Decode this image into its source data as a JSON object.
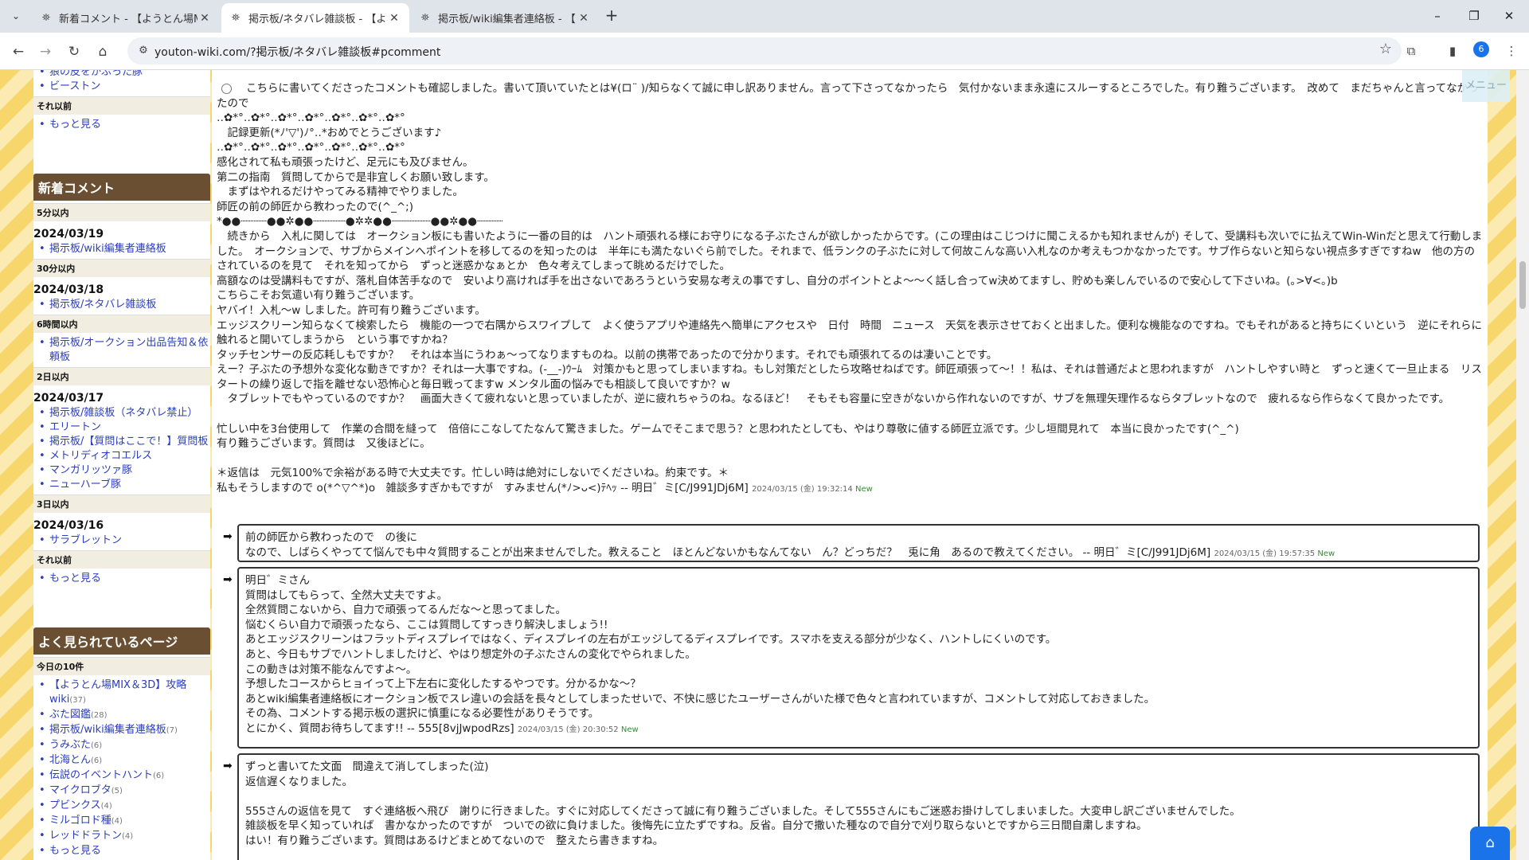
{
  "browser": {
    "tabs": [
      {
        "title": "新着コメント - 【ようとん場MIX＆3D",
        "active": false
      },
      {
        "title": "掲示板/ネタバレ雑談板 - 【ようとん",
        "active": true
      },
      {
        "title": "掲示板/wiki編集者連絡板 - 【よう",
        "active": false
      }
    ],
    "url": "youton-wiki.com/?掲示板/ネタバレ雑談板#pcomment",
    "profile_initial": "6",
    "icons": {
      "back": "←",
      "forward": "→",
      "reload": "↻",
      "home": "⌂",
      "star": "☆",
      "extensions": "⧉",
      "sidepanel": "▮",
      "more": "⋮",
      "tabmenu": "⌄",
      "newtab": "+",
      "minimize": "–",
      "restore": "❐",
      "close": "✕",
      "favicon": "⛯",
      "tab_close": "✕",
      "site": "⚙"
    }
  },
  "sidebar": {
    "top_items": [
      "狼の皮をかぶった豚",
      "ビーストン"
    ],
    "before_label": "それ以前",
    "more_label": "もっと見る",
    "recent_comments": {
      "heading": "新着コメント",
      "sections": [
        {
          "label": "5分以内",
          "date": "2024/03/19",
          "items": [
            "掲示板/wiki編集者連絡板"
          ]
        },
        {
          "label": "30分以内",
          "date": "2024/03/18",
          "items": [
            "掲示板/ネタバレ雑談板"
          ]
        },
        {
          "label": "6時間以内",
          "date": "",
          "items": [
            "掲示板/オークション出品告知＆依頼板"
          ]
        },
        {
          "label": "2日以内",
          "date": "2024/03/17",
          "items": [
            "掲示板/雑談板（ネタバレ禁止）",
            "エリートン",
            "掲示板/【質問はここで！】質問板",
            "メトリディオコエルス",
            "マンガリッツァ豚",
            "ニューハーブ豚"
          ]
        },
        {
          "label": "3日以内",
          "date": "2024/03/16",
          "items": [
            "サラブレットン"
          ]
        }
      ],
      "before_label": "それ以前",
      "more_label": "もっと見る"
    },
    "popular": {
      "heading": "よく見られているページ",
      "label": "今日の10件",
      "items": [
        {
          "name": "【ようとん場MIX＆3D】攻略wiki",
          "count": "(37)"
        },
        {
          "name": "ぶた図鑑",
          "count": "(28)"
        },
        {
          "name": "掲示板/wiki編集者連絡板",
          "count": "(7)"
        },
        {
          "name": "うみぶた",
          "count": "(6)"
        },
        {
          "name": "北海とん",
          "count": "(6)"
        },
        {
          "name": "伝説のイベントハント",
          "count": "(6)"
        },
        {
          "name": "マイクロブタ",
          "count": "(5)"
        },
        {
          "name": "プビンクス",
          "count": "(4)"
        },
        {
          "name": "ミルゴロド種",
          "count": "(4)"
        },
        {
          "name": "レッドドラトン",
          "count": "(4)"
        }
      ],
      "more_label": "もっと見る"
    }
  },
  "comment": {
    "lines": [
      "こちらに書いてくださったコメントも確認しました。書いて頂いていたとは¥(ロ¨ )/知らなくて誠に申し訳ありません。言って下さってなかったら　気付かないまま永遠にスルーするところでした。有り難うございます。　改めて　まだちゃんと言ってなかったので",
      "‥✿*°‥✿*°‥✿*°‥✿*°‥✿*°‥✿*°‥✿*°",
      "　記録更新(*ﾉ'▽')ﾉ°‥*おめでとうございます♪",
      "‥✿*°‥✿*°‥✿*°‥✿*°‥✿*°‥✿*°‥✿*°",
      "感化されて私も頑張ったけど、足元にも及びません。",
      "第二の指南　質問してからで是非宜しくお願い致します。",
      "　まずはやれるだけやってみる精神でやりました。",
      "師匠の前の師匠から教わったので(^_^;)",
      "*●●┈┈┈┈●●✲●●┈┈┈┈┈●✲✲●●┈┈┈┈┈┈●●✲●●┈┈┈┈",
      "　続きから　入札に関しては　オークション板にも書いたように一番の目的は　ハント頑張れる様にお守りになる子ぶたさんが欲しかったからです。(この理由はこじつけに聞こえるかも知れませんが) そして、受講料も次いでに払えてWin-Winだと思えて行動しました。　オークションで、サブからメインへポイントを移してるのを知ったのは　半年にも満たないぐら前でした。それまで、低ランクの子ぶたに対して何故こんな高い入札なのか考えもつかなかったです。サブ作らないと知らない視点多すぎですねw　他の方のされているのを見て　それを知ってから　ずっと迷惑かなぁとか　色々考えてしまって眺めるだけでした。",
      "高額なのは受講料もですが、落札自体苦手なので　安いより高ければ手を出さないであろうという安易な考えの事ですし、自分のポイントとよ〜〜く話し合ってw決めてますし、貯めも楽しんでいるので安心して下さいね。(｡>∀<｡)b",
      "こちらこそお気遣い有り難うございます。",
      "ヤバイ！入札〜w しました。許可有り難うございます。",
      "エッジスクリーン知らなくて検索したら　機能の一つで右隅からスワイプして　よく使うアプリや連絡先へ簡単にアクセスや　日付　時間　ニュース　天気を表示させておくと出ました。便利な機能なのですね。でもそれがあると持ちにくいという　逆にそれらに触れると開いてしまうから　という事ですかね？",
      "タッチセンサーの反応耗しもですか？　それは本当にうわぁ〜ってなりますものね。以前の携帯であったので分かります。それでも頑張れてるのは凄いことです。",
      "えー？子ぶたの予想外な変化な動きですか？それは一大事ですね。(-__-)ｳｰﾑ　対策かもと思ってしまいますね。もし対策だとしたら攻略せねばです。師匠頑張って〜！！私は、それは普通だよと思われますが　ハントしやすい時と　ずっと速くて一旦止まる　リスタートの繰り返しで指を離せない恐怖心と毎日戦ってますw メンタル面の悩みでも相談して良いですか？w",
      "　タブレットでもやっているのですか？　画面大きくて疲れないと思っていましたが、逆に疲れちゃうのね。なるほど！　そもそも容量に空きがないから作れないのですが、サブを無理矢理作るならタブレットなので　疲れるなら作らなくて良かったです。",
      "",
      "忙しい中を3台使用して　作業の合間を縫って　倍倍にこなしてたなんて驚きました。ゲームでそこまで思う？と思われたとしても、やはり尊敬に値する師匠立派です。少し垣間見れて　本当に良かったです(^_^)",
      "有り難うございます。質問は　又後ほどに。",
      "",
      "＊返信は　元気100%で余裕がある時で大丈夫です。忙しい時は絶対にしないでくださいね。約束です。＊"
    ],
    "last_line": "私もそうしますので o(*^▽^*)o　雑談多すぎかもですが　すみません(*ﾉ>ᴗ<)ﾃﾍｯ",
    "author": "-- 明日゛ミ[C/J991JDj6M]",
    "timestamp": "2024/03/15 (金) 19:32:14",
    "new_label": "New"
  },
  "replies": [
    {
      "lines": [
        "前の師匠から教わったので　の後に"
      ],
      "last_line": "なので、しばらくやってて悩んでも中々質問することが出来ませんでした。教えること　ほとんどないかもなんてない　ん？どっちだ？　兎に角　あるので教えてください。",
      "author": "-- 明日゛ミ[C/J991JDj6M]",
      "timestamp": "2024/03/15 (金) 19:57:35",
      "new_label": "New"
    },
    {
      "lines": [
        "明日゛ミさん",
        "質問はしてもらって、全然大丈夫ですよ。",
        "全然質問こないから、自力で頑張ってるんだな〜と思ってました。",
        "悩むくらい自力で頑張ったなら、ここは質問してすっきり解決しましょう!!",
        "あとエッジスクリーンはフラットディスプレイではなく、ディスプレイの左右がエッジしてるディスプレイです。スマホを支える部分が少なく、ハントしにくいのです。",
        "あと、今日もサブでハントしましたけど、やはり想定外の子ぶたさんの変化でやられました。",
        "この動きは対策不能なんですよ〜。",
        "予想したコースからヒョイって上下左右に変化したするやつです。分かるかな〜？",
        "あとwiki編集者連絡板にオークション板でスレ違いの会話を長々としてしまったせいで、不快に感じたユーザーさんがいた様で色々と言われていますが、コメントして対応しておきました。",
        "その為、コメントする掲示板の選択に慎重になる必要性がありそうです。"
      ],
      "last_line": "とにかく、質問お待ちしてます!!",
      "author": "-- 555[8vjJwpodRzs]",
      "timestamp": "2024/03/15 (金) 20:30:52",
      "new_label": "New"
    },
    {
      "lines": [
        "ずっと書いてた文面　間違えて消してしまった(泣)",
        "返信遅くなりました。",
        "",
        "555さんの返信を見て　すぐ連絡板へ飛び　謝りに行きました。すぐに対応してくださって誠に有り難うございました。そして555さんにもご迷惑お掛けしてしまいました。大変申し訳ございませんでした。",
        "雑談板を早く知っていれば　書かなかったのですが　ついでの欲に負けました。後悔先に立たずですね。反省。自分で撒いた種なので自分で刈り取らないとですから三日間自粛しますね。",
        "はい！有り難うございます。質問はあるけどまとめてないので　整えたら書きますね。"
      ],
      "last_line": "",
      "author": "",
      "timestamp": "",
      "new_label": ""
    }
  ],
  "ui": {
    "menu_label": "メニュー",
    "arrow": "➡",
    "fab_icon": "⌂"
  },
  "colors": {
    "link": "#2a3dbd",
    "sidebar_heading_bg": "#6a4f33",
    "stripe_a": "#f7d66b",
    "stripe_b": "#fbeab2",
    "new_label": "#3a8a3a",
    "accent": "#1a73e8"
  }
}
